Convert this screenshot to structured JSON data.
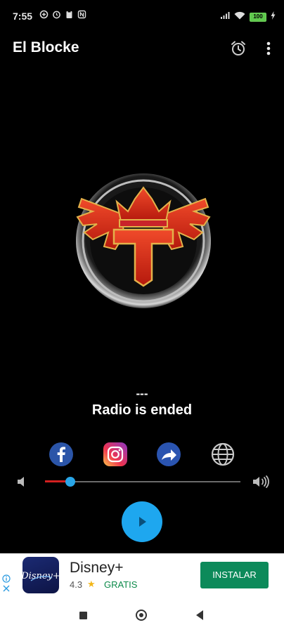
{
  "status_bar": {
    "time": "7:55",
    "battery": "100",
    "icons": [
      "data-saver-icon",
      "alarm-icon",
      "clipboard-icon",
      "nfc-icon",
      "signal-icon",
      "wifi-icon",
      "battery-icon",
      "charging-icon"
    ]
  },
  "app_bar": {
    "title": "El Blocke",
    "actions": [
      "alarm-clock-icon",
      "more-vert-icon"
    ]
  },
  "player": {
    "track_title": "---",
    "status": "Radio is ended",
    "volume_level": 0.13
  },
  "social": [
    "facebook-icon",
    "instagram-icon",
    "share-icon",
    "globe-icon"
  ],
  "ad": {
    "app_name": "Disney+",
    "rating": "4.3",
    "price": "GRATIS",
    "install_label": "INSTALAR",
    "logo_text": "Disney+"
  },
  "colors": {
    "accent": "#1ea7ef",
    "slider_fill": "#d32020",
    "install_button": "#0c8a5a",
    "background": "#000000"
  }
}
